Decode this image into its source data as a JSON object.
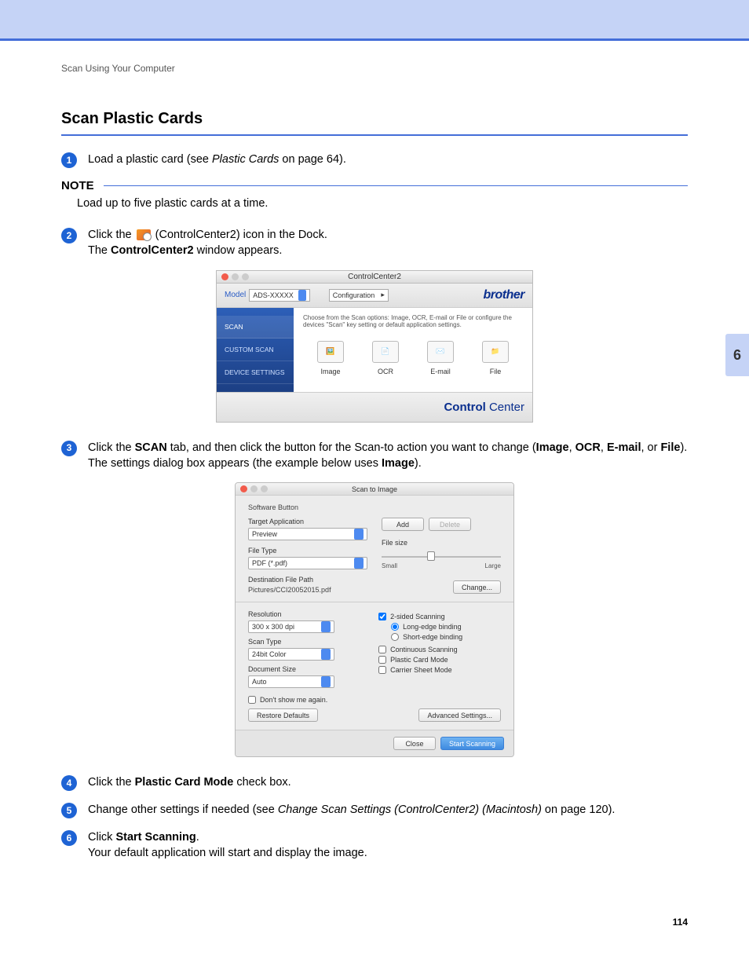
{
  "breadcrumb": "Scan Using Your Computer",
  "heading": "Scan Plastic Cards",
  "chapter": "6",
  "page_number": "114",
  "note": {
    "label": "NOTE",
    "text": "Load up to five plastic cards at a time."
  },
  "steps": {
    "s1": {
      "pre": "Load a plastic card (see ",
      "link": "Plastic Cards",
      "post": " on page 64)."
    },
    "s2": {
      "a": "Click the ",
      "b": " (ControlCenter2) icon in the Dock.",
      "c1": "The ",
      "c2": "ControlCenter2",
      "c3": " window appears."
    },
    "s3": {
      "a": "Click the ",
      "b": "SCAN",
      "c": " tab, and then click the button for the Scan-to action you want to change (",
      "d": "Image",
      "e": ", ",
      "f": "OCR",
      "g": ", ",
      "h": "E-mail",
      "i": ", or ",
      "j": "File",
      "k": "). The settings dialog box appears (the example below uses ",
      "l": "Image",
      "m": ")."
    },
    "s4": {
      "a": "Click the ",
      "b": "Plastic Card Mode",
      "c": " check box."
    },
    "s5": {
      "a": "Change other settings if needed (see ",
      "b": "Change Scan Settings (ControlCenter2) (Macintosh)",
      "c": " on page 120)."
    },
    "s6": {
      "a": "Click ",
      "b": "Start Scanning",
      "c": ".",
      "d": "Your default application will start and display the image."
    }
  },
  "cc2": {
    "title": "ControlCenter2",
    "model_label": "Model",
    "model_value": "ADS-XXXXX",
    "config_label": "Configuration",
    "brand": "brother",
    "desc": "Choose from the Scan options: Image, OCR, E-mail or File or configure the devices \"Scan\" key setting or default application settings.",
    "side": [
      "SCAN",
      "CUSTOM SCAN",
      "DEVICE SETTINGS"
    ],
    "buttons": [
      "Image",
      "OCR",
      "E-mail",
      "File"
    ],
    "footer_brand_bold": "Control",
    "footer_brand_light": " Center"
  },
  "dlg": {
    "title": "Scan to Image",
    "tab": "Software Button",
    "labels": {
      "target": "Target Application",
      "filetype": "File Type",
      "filesize": "File size",
      "small": "Small",
      "large": "Large",
      "destpath": "Destination File Path",
      "resolution": "Resolution",
      "scantype": "Scan Type",
      "docsize": "Document Size"
    },
    "values": {
      "target": "Preview",
      "filetype": "PDF (*.pdf)",
      "path": "Pictures/CCI20052015.pdf",
      "resolution": "300 x 300 dpi",
      "scantype": "24bit Color",
      "docsize": "Auto"
    },
    "buttons": {
      "add": "Add",
      "delete": "Delete",
      "change": "Change...",
      "restore": "Restore Defaults",
      "advanced": "Advanced Settings...",
      "close": "Close",
      "start": "Start Scanning"
    },
    "checks": {
      "twosided": "2-sided Scanning",
      "longedge": "Long-edge binding",
      "shortedge": "Short-edge binding",
      "continuous": "Continuous Scanning",
      "plastic": "Plastic Card Mode",
      "carrier": "Carrier Sheet Mode",
      "dontshow": "Don't show me again."
    }
  }
}
